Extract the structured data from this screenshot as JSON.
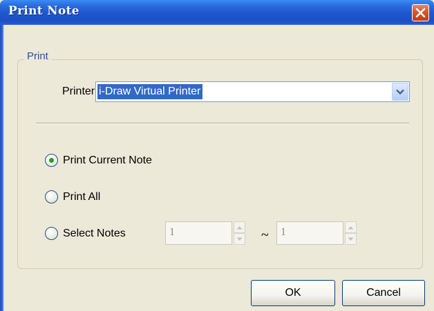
{
  "window": {
    "title": "Print Note"
  },
  "group": {
    "label": "Print"
  },
  "printer": {
    "label": "Printer",
    "selected": "i-Draw Virtual Printer"
  },
  "options": [
    {
      "label": "Print Current Note",
      "checked": true
    },
    {
      "label": "Print All",
      "checked": false
    },
    {
      "label": "Select Notes",
      "checked": false
    }
  ],
  "range": {
    "from": "1",
    "separator": "~",
    "to": "1"
  },
  "buttons": {
    "ok": "OK",
    "cancel": "Cancel"
  },
  "colors": {
    "title_bar": "#1e56cf",
    "selection": "#316ac5",
    "radio_dot": "#21a121",
    "close": "#d5572e",
    "dialog_bg": "#ece9d8"
  },
  "icons": {
    "close": "close-icon",
    "dropdown": "chevron-down-icon",
    "spin_up": "arrow-up-icon",
    "spin_down": "arrow-down-icon"
  }
}
